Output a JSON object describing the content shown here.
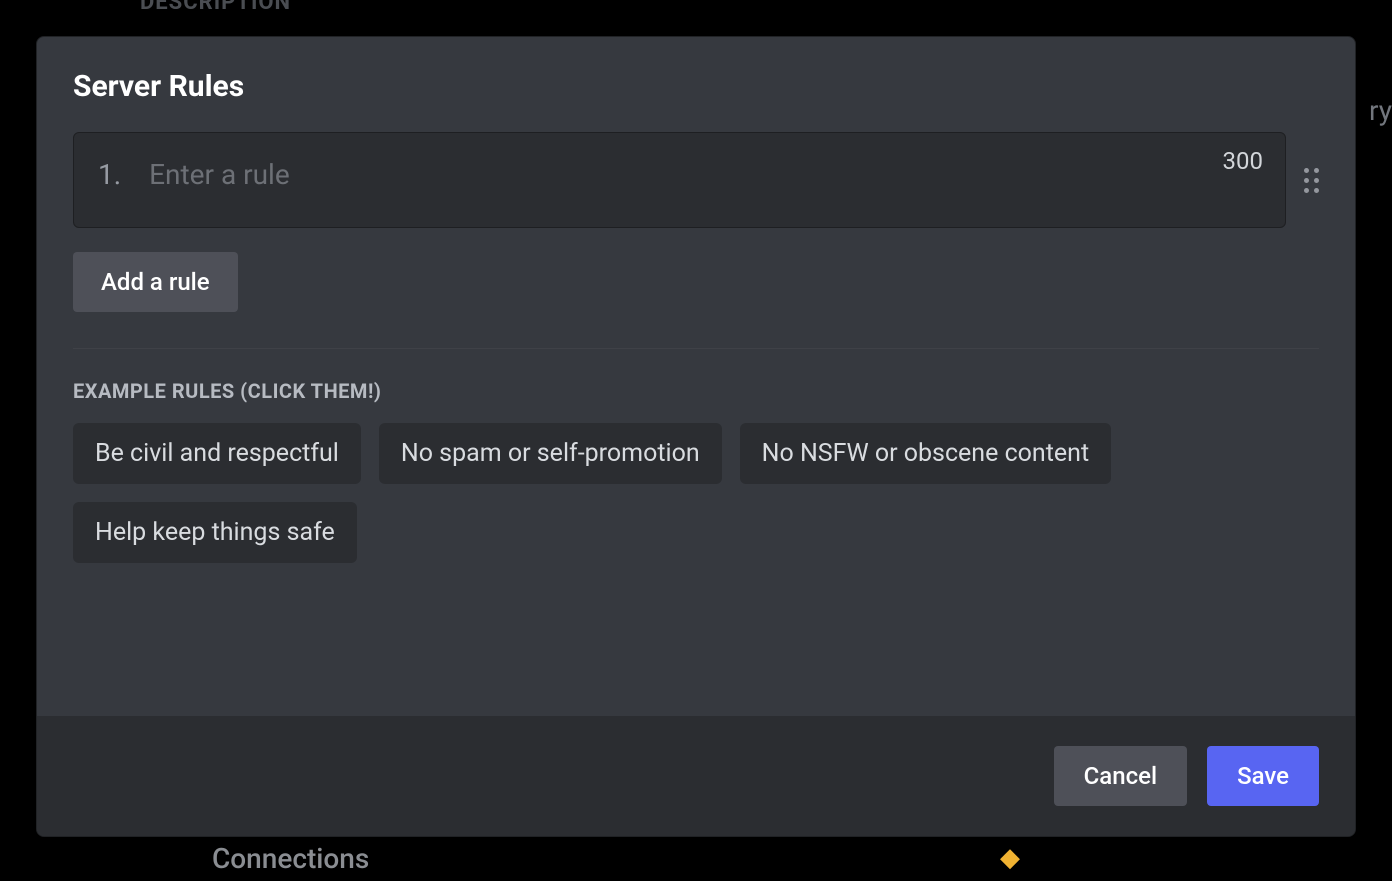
{
  "backdrop": {
    "top_label": "DESCRIPTION",
    "right_fragment": "ry",
    "bottom_label": "Connections",
    "star_glyph": "◆"
  },
  "modal": {
    "title": "Server Rules",
    "rule_input": {
      "number": "1.",
      "value": "",
      "placeholder": "Enter a rule",
      "char_limit": "300"
    },
    "add_rule_label": "Add a rule",
    "example_heading": "EXAMPLE RULES (CLICK THEM!)",
    "example_rules": [
      "Be civil and respectful",
      "No spam or self-promotion",
      "No NSFW or obscene content",
      "Help keep things safe"
    ],
    "footer": {
      "cancel_label": "Cancel",
      "save_label": "Save"
    }
  },
  "colors": {
    "modal_bg": "#36393f",
    "input_bg": "#2b2d31",
    "footer_bg": "#2b2d31",
    "primary_button": "#5865f2",
    "secondary_button": "#4e5058"
  }
}
